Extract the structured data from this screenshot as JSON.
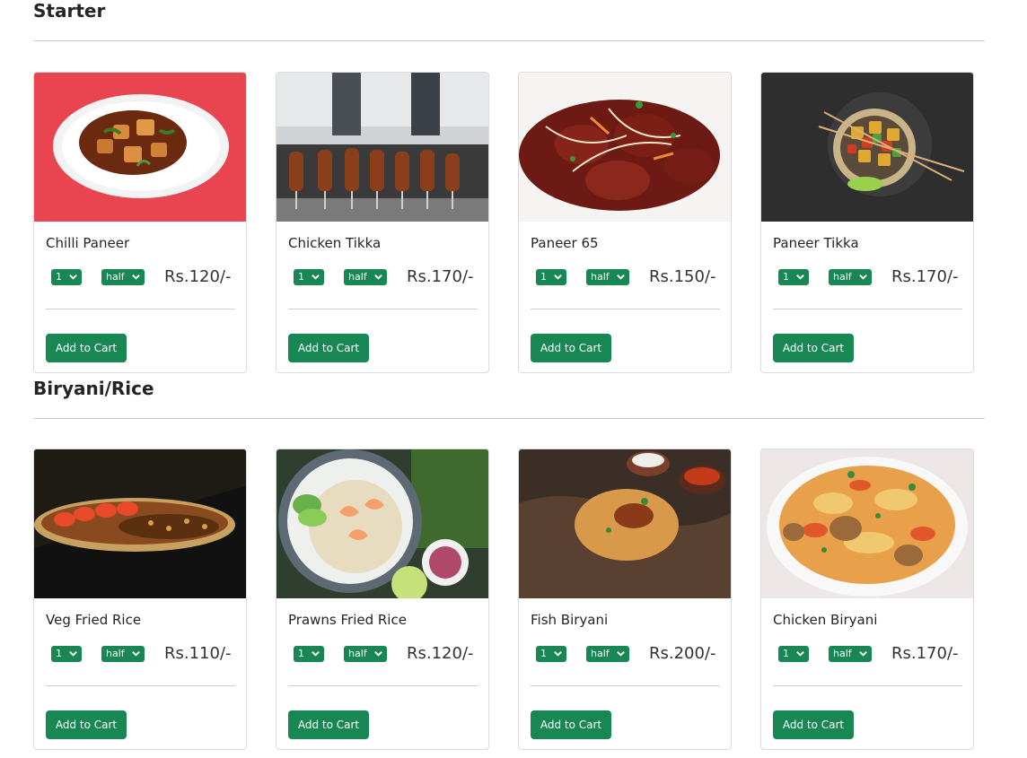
{
  "colors": {
    "accent_green": "#198754",
    "card_border": "#dcdcdc",
    "rule": "#cfcfcf"
  },
  "sections": [
    {
      "title": "Starter",
      "items": [
        {
          "name": "Chilli Paneer",
          "quantity": "1",
          "portion": "half",
          "price": "Rs.120/-",
          "button": "Add to Cart",
          "image_icon": "chilli-paneer-image"
        },
        {
          "name": "Chicken Tikka",
          "quantity": "1",
          "portion": "half",
          "price": "Rs.170/-",
          "button": "Add to Cart",
          "image_icon": "chicken-tikka-image"
        },
        {
          "name": "Paneer 65",
          "quantity": "1",
          "portion": "half",
          "price": "Rs.150/-",
          "button": "Add to Cart",
          "image_icon": "paneer-65-image"
        },
        {
          "name": "Paneer Tikka",
          "quantity": "1",
          "portion": "half",
          "price": "Rs.170/-",
          "button": "Add to Cart",
          "image_icon": "paneer-tikka-image"
        }
      ]
    },
    {
      "title": "Biryani/Rice",
      "items": [
        {
          "name": "Veg Fried Rice",
          "quantity": "1",
          "portion": "half",
          "price": "Rs.110/-",
          "button": "Add to Cart",
          "image_icon": "veg-fried-rice-image"
        },
        {
          "name": "Prawns Fried Rice",
          "quantity": "1",
          "portion": "half",
          "price": "Rs.120/-",
          "button": "Add to Cart",
          "image_icon": "prawns-fried-rice-image"
        },
        {
          "name": "Fish Biryani",
          "quantity": "1",
          "portion": "half",
          "price": "Rs.200/-",
          "button": "Add to Cart",
          "image_icon": "fish-biryani-image"
        },
        {
          "name": "Chicken Biryani",
          "quantity": "1",
          "portion": "half",
          "price": "Rs.170/-",
          "button": "Add to Cart",
          "image_icon": "chicken-biryani-image"
        }
      ]
    }
  ]
}
